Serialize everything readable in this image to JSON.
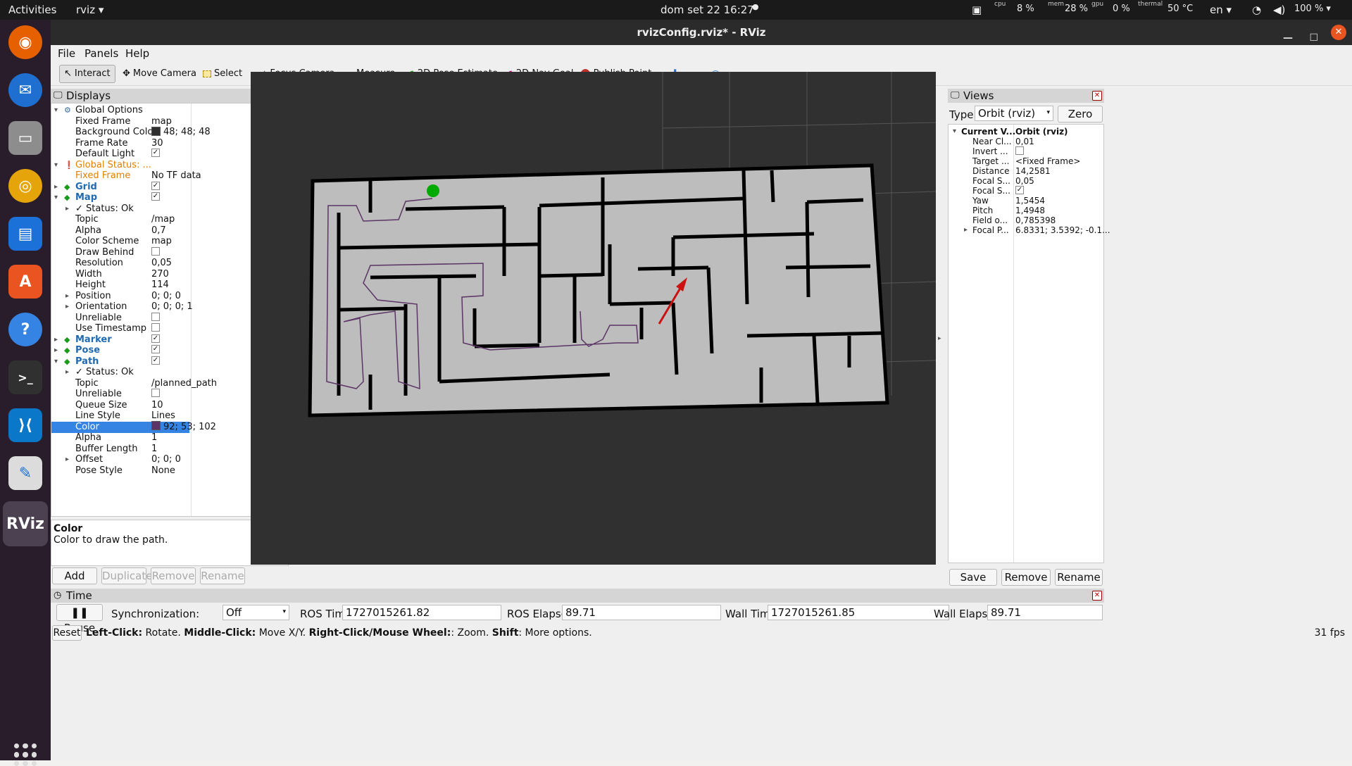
{
  "topbar": {
    "activities": "Activities",
    "app": "rviz ▾",
    "clock": "dom set 22  16:27",
    "cpu_label": "cpu",
    "cpu": "8 %",
    "mem_label": "mem",
    "mem": "28 %",
    "gpu_label": "gpu",
    "gpu": "0 %",
    "thermal_label": "thermal",
    "thermal": "50 °C",
    "lang": "en ▾",
    "battery": "100 % ▾"
  },
  "window": {
    "title": "rvizConfig.rviz* - RViz"
  },
  "menu": {
    "file": "File",
    "panels": "Panels",
    "help": "Help"
  },
  "toolbar": {
    "interact": "Interact",
    "move_camera": "Move Camera",
    "select": "Select",
    "focus_camera": "Focus Camera",
    "measure": "Measure",
    "pose_estimate": "2D Pose Estimate",
    "nav_goal": "2D Nav Goal",
    "publish_point": "Publish Point"
  },
  "displays": {
    "title": "Displays",
    "rows": [
      {
        "k": "Global Options",
        "v": "",
        "indent": 0,
        "arrow": "▾",
        "kind": "icon-gear"
      },
      {
        "k": "Fixed Frame",
        "v": "map",
        "indent": 1
      },
      {
        "k": "Background Color",
        "v": "48; 48; 48",
        "indent": 1,
        "swatch": "#303030"
      },
      {
        "k": "Frame Rate",
        "v": "30",
        "indent": 1
      },
      {
        "k": "Default Light",
        "v": "",
        "indent": 1,
        "check": true
      },
      {
        "k": "Global Status: ...",
        "v": "",
        "indent": 0,
        "arrow": "▾",
        "kind": "warn"
      },
      {
        "k": "Fixed Frame",
        "v": "No TF data",
        "indent": 1,
        "kind": "warn"
      },
      {
        "k": "Grid",
        "v": "",
        "indent": 0,
        "arrow": "▸",
        "kind": "blue",
        "check": true
      },
      {
        "k": "Map",
        "v": "",
        "indent": 0,
        "arrow": "▾",
        "kind": "blue",
        "check": true
      },
      {
        "k": "✓  Status: Ok",
        "v": "",
        "indent": 1,
        "arrow": "▸"
      },
      {
        "k": "Topic",
        "v": "/map",
        "indent": 1
      },
      {
        "k": "Alpha",
        "v": "0,7",
        "indent": 1
      },
      {
        "k": "Color Scheme",
        "v": "map",
        "indent": 1
      },
      {
        "k": "Draw Behind",
        "v": "",
        "indent": 1,
        "check": false
      },
      {
        "k": "Resolution",
        "v": "0,05",
        "indent": 1
      },
      {
        "k": "Width",
        "v": "270",
        "indent": 1
      },
      {
        "k": "Height",
        "v": "114",
        "indent": 1
      },
      {
        "k": "Position",
        "v": "0; 0; 0",
        "indent": 1,
        "arrow": "▸"
      },
      {
        "k": "Orientation",
        "v": "0; 0; 0; 1",
        "indent": 1,
        "arrow": "▸"
      },
      {
        "k": "Unreliable",
        "v": "",
        "indent": 1,
        "check": false
      },
      {
        "k": "Use Timestamp",
        "v": "",
        "indent": 1,
        "check": false
      },
      {
        "k": "Marker",
        "v": "",
        "indent": 0,
        "arrow": "▸",
        "kind": "blue",
        "check": true
      },
      {
        "k": "Pose",
        "v": "",
        "indent": 0,
        "arrow": "▸",
        "kind": "blue",
        "check": true
      },
      {
        "k": "Path",
        "v": "",
        "indent": 0,
        "arrow": "▾",
        "kind": "blue",
        "check": true
      },
      {
        "k": "✓  Status: Ok",
        "v": "",
        "indent": 1,
        "arrow": "▸"
      },
      {
        "k": "Topic",
        "v": "/planned_path",
        "indent": 1
      },
      {
        "k": "Unreliable",
        "v": "",
        "indent": 1,
        "check": false
      },
      {
        "k": "Queue Size",
        "v": "10",
        "indent": 1
      },
      {
        "k": "Line Style",
        "v": "Lines",
        "indent": 1
      },
      {
        "k": "Color",
        "v": "92; 53; 102",
        "indent": 1,
        "swatch": "#5c3566",
        "hl": true
      },
      {
        "k": "Alpha",
        "v": "1",
        "indent": 1
      },
      {
        "k": "Buffer Length",
        "v": "1",
        "indent": 1
      },
      {
        "k": "Offset",
        "v": "0; 0; 0",
        "indent": 1,
        "arrow": "▸"
      },
      {
        "k": "Pose Style",
        "v": "None",
        "indent": 1
      }
    ]
  },
  "desc": {
    "title": "Color",
    "text": "Color to draw the path."
  },
  "buttons": {
    "add": "Add",
    "duplicate": "Duplicate",
    "remove": "Remove",
    "rename": "Rename"
  },
  "views": {
    "title": "Views",
    "type_label": "Type:",
    "type_value": "Orbit (rviz)",
    "zero": "Zero",
    "rows": [
      {
        "k": "Current V...",
        "v": "Orbit (rviz)",
        "bold": true,
        "arrow": "▾"
      },
      {
        "k": "Near Cl...",
        "v": "0,01"
      },
      {
        "k": "Invert ...",
        "v": "",
        "check": false
      },
      {
        "k": "Target ...",
        "v": "<Fixed Frame>"
      },
      {
        "k": "Distance",
        "v": "14,2581"
      },
      {
        "k": "Focal S...",
        "v": "0,05"
      },
      {
        "k": "Focal S...",
        "v": "",
        "check": true
      },
      {
        "k": "Yaw",
        "v": "1,5454"
      },
      {
        "k": "Pitch",
        "v": "1,4948"
      },
      {
        "k": "Field o...",
        "v": "0,785398"
      },
      {
        "k": "Focal P...",
        "v": "6.8331; 3.5392; -0.1...",
        "arrow": "▸"
      }
    ],
    "save": "Save",
    "remove": "Remove",
    "rename": "Rename"
  },
  "time": {
    "title": "Time",
    "pause": "Pause",
    "sync_label": "Synchronization:",
    "sync_value": "Off",
    "ros_time_label": "ROS Time:",
    "ros_time": "1727015261.82",
    "ros_elapsed_label": "ROS Elapsed:",
    "ros_elapsed": "89.71",
    "wall_time_label": "Wall Time:",
    "wall_time": "1727015261.85",
    "wall_elapsed_label": "Wall Elapsed:",
    "wall_elapsed": "89.71"
  },
  "status": {
    "reset": "Reset",
    "b1": "Left-Click:",
    "t1": " Rotate. ",
    "b2": "Middle-Click:",
    "t2": " Move X/Y. ",
    "b3": "Right-Click/Mouse Wheel:",
    "t3": ": Zoom. ",
    "b4": "Shift",
    "t4": ": More options.",
    "fps": "31 fps"
  },
  "colors": {
    "background": "#303030",
    "map_free": "#bdbdbd",
    "map_wall": "#000000",
    "path": "#5c3566",
    "goal": "#00aa00",
    "pose": "#cc1111"
  }
}
